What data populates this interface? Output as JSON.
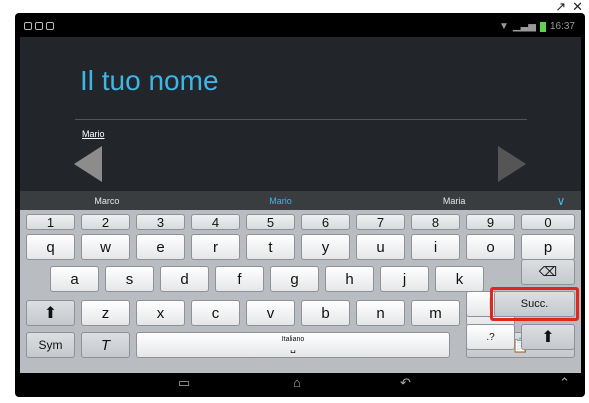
{
  "statusbar": {
    "time": "16:37"
  },
  "form": {
    "title": "Il tuo nome",
    "preview": "Mario"
  },
  "suggestions": [
    "Marco",
    "Mario",
    "Maria"
  ],
  "keyboard": {
    "numbers": [
      "1",
      "2",
      "3",
      "4",
      "5",
      "6",
      "7",
      "8",
      "9",
      "0"
    ],
    "row1": [
      "q",
      "w",
      "e",
      "r",
      "t",
      "y",
      "u",
      "i",
      "o",
      "p"
    ],
    "row2": [
      "a",
      "s",
      "d",
      "f",
      "g",
      "h",
      "j",
      "k",
      "l"
    ],
    "row3": [
      "z",
      "x",
      "c",
      "v",
      "b",
      "n",
      "m",
      ",!",
      ".?"
    ],
    "backspace_icon": "backspace-icon",
    "next_label": "Succ.",
    "shift_icon": "shift-icon",
    "sym_label": "Sym",
    "handwriting_label": "T",
    "space_label": "Italiano",
    "clipboard_icon": "clipboard-icon"
  },
  "navbar": {
    "recent_icon": "recent-apps-icon",
    "home_icon": "home-icon",
    "back_icon": "back-icon",
    "up_icon": "chevron-up-icon"
  },
  "highlight_color": "#e0261d",
  "accent_color": "#3fb5e6"
}
